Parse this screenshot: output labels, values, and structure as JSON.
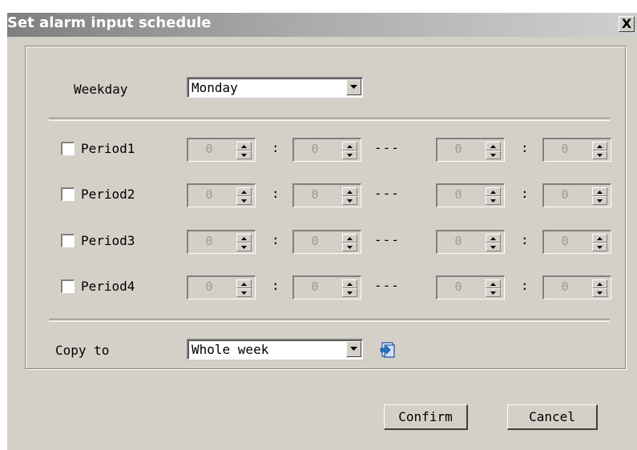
{
  "window": {
    "title": "Set alarm input schedule",
    "close_glyph": "X"
  },
  "weekday": {
    "label": "Weekday",
    "selected": "Monday"
  },
  "periods": [
    {
      "label": "Period1",
      "checked": false,
      "start_hour": "0",
      "start_minute": "0",
      "end_hour": "0",
      "end_minute": "0"
    },
    {
      "label": "Period2",
      "checked": false,
      "start_hour": "0",
      "start_minute": "0",
      "end_hour": "0",
      "end_minute": "0"
    },
    {
      "label": "Period3",
      "checked": false,
      "start_hour": "0",
      "start_minute": "0",
      "end_hour": "0",
      "end_minute": "0"
    },
    {
      "label": "Period4",
      "checked": false,
      "start_hour": "0",
      "start_minute": "0",
      "end_hour": "0",
      "end_minute": "0"
    }
  ],
  "separators": {
    "time": ":",
    "range": "---"
  },
  "copy": {
    "label": "Copy to",
    "selected": "Whole week",
    "icon": "copy-apply-icon"
  },
  "buttons": {
    "confirm": "Confirm",
    "cancel": "Cancel"
  },
  "colors": {
    "dialog_bg": "#d4d0c8",
    "disabled_text": "#9a9a9a",
    "title_text": "#ffffff"
  }
}
